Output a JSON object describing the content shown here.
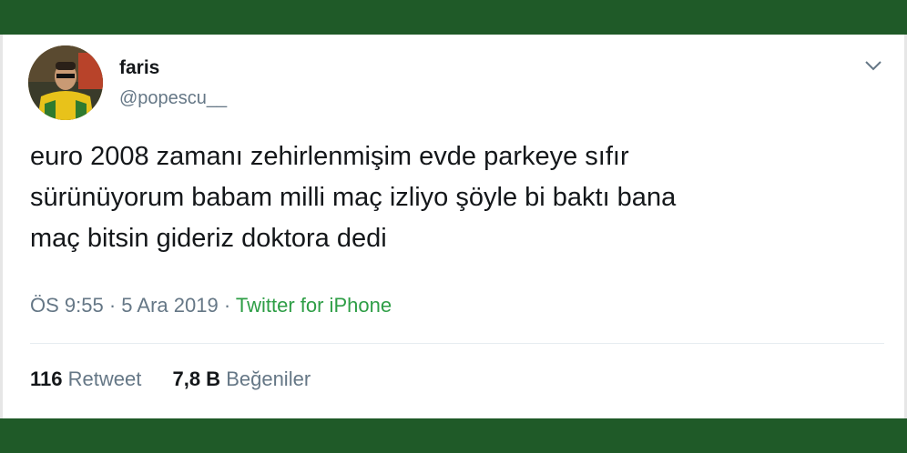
{
  "colors": {
    "frame": "#1f5a28",
    "text": "#14171a",
    "muted": "#657786",
    "source_link": "#2e9e46"
  },
  "user": {
    "name": "faris",
    "handle": "@popescu__",
    "avatar_icon": "user-avatar"
  },
  "tweet": {
    "lines": [
      "euro 2008 zamanı zehirlenmişim evde parkeye sıfır",
      "sürünüyorum babam milli maç izliyo şöyle bi baktı bana",
      "maç bitsin gideriz doktora dedi"
    ]
  },
  "meta": {
    "time": "ÖS 9:55",
    "sep1": " · ",
    "date": "5 Ara 2019",
    "sep2": " · ",
    "source": "Twitter for iPhone"
  },
  "stats": {
    "retweets_count": "116",
    "retweets_label": "Retweet",
    "likes_count": "7,8 B",
    "likes_label": "Beğeniler"
  },
  "menu_icon": "chevron-down-icon"
}
